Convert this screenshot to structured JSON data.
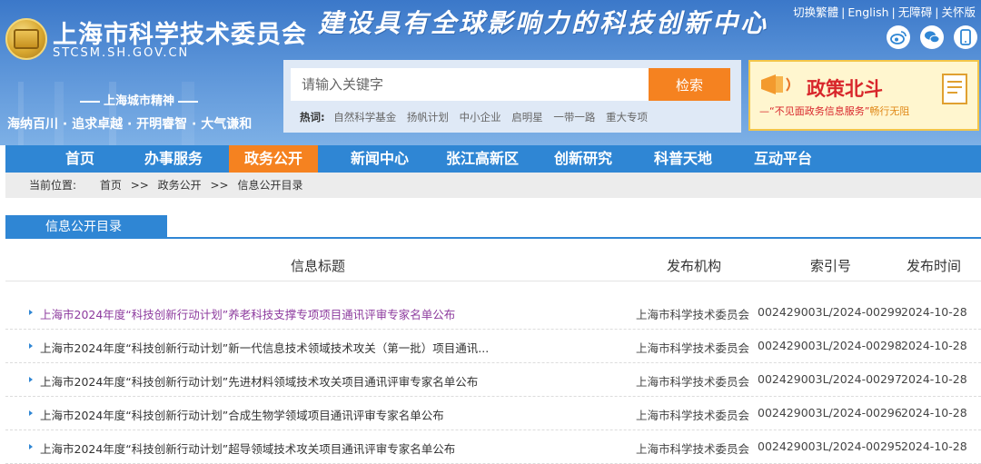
{
  "header": {
    "site_title": "上海市科学技术委员会",
    "site_domain": "STCSM.SH.GOV.CN",
    "slogan": "建设具有全球影响力的科技创新中心",
    "spirit_label": "上海城市精神",
    "spirit_text": "海纳百川 · 追求卓越 · 开明睿智 · 大气谦和",
    "top_links": [
      "切换繁體",
      "English",
      "无障碍",
      "关怀版"
    ],
    "top_link_sep": "|",
    "social_icons": [
      "weibo-icon",
      "wechat-icon",
      "mobile-icon"
    ]
  },
  "search": {
    "placeholder": "请输入关键字",
    "button_label": "检索",
    "hot_label": "热词:",
    "hot_words": [
      "自然科学基金",
      "扬帆计划",
      "中小企业",
      "启明星",
      "一带一路",
      "重大专项"
    ]
  },
  "promo": {
    "title": "政策北斗",
    "subtitle_prefix": "—“不见面政务信息服务”",
    "subtitle_highlight": "畅行无阻"
  },
  "nav": {
    "items": [
      "首页",
      "办事服务",
      "政务公开",
      "新闻中心",
      "张江高新区",
      "创新研究",
      "科普天地",
      "互动平台"
    ],
    "active_index": 2
  },
  "breadcrumb": {
    "label": "当前位置:",
    "items": [
      "首页",
      "政务公开",
      "信息公开目录"
    ],
    "sep": ">>"
  },
  "section": {
    "tab_label": "信息公开目录"
  },
  "table": {
    "headers": {
      "title": "信息标题",
      "org": "发布机构",
      "index": "索引号",
      "date": "发布时间"
    },
    "rows": [
      {
        "title": "上海市2024年度“科技创新行动计划”养老科技支撑专项项目通讯评审专家名单公布",
        "org": "上海市科学技术委员会",
        "index": "002429003L/2024-00299",
        "date": "2024-10-28",
        "visited": true
      },
      {
        "title": "上海市2024年度“科技创新行动计划”新一代信息技术领域技术攻关（第一批）项目通讯...",
        "org": "上海市科学技术委员会",
        "index": "002429003L/2024-00298",
        "date": "2024-10-28",
        "visited": false
      },
      {
        "title": "上海市2024年度“科技创新行动计划”先进材料领域技术攻关项目通讯评审专家名单公布",
        "org": "上海市科学技术委员会",
        "index": "002429003L/2024-00297",
        "date": "2024-10-28",
        "visited": false
      },
      {
        "title": "上海市2024年度“科技创新行动计划”合成生物学领域项目通讯评审专家名单公布",
        "org": "上海市科学技术委员会",
        "index": "002429003L/2024-00296",
        "date": "2024-10-28",
        "visited": false
      },
      {
        "title": "上海市2024年度“科技创新行动计划”超导领域技术攻关项目通讯评审专家名单公布",
        "org": "上海市科学技术委员会",
        "index": "002429003L/2024-00295",
        "date": "2024-10-28",
        "visited": false
      }
    ]
  },
  "colors": {
    "nav_blue": "#2f86d4",
    "accent_orange": "#f58220",
    "visited_link": "#8d3b9e"
  }
}
